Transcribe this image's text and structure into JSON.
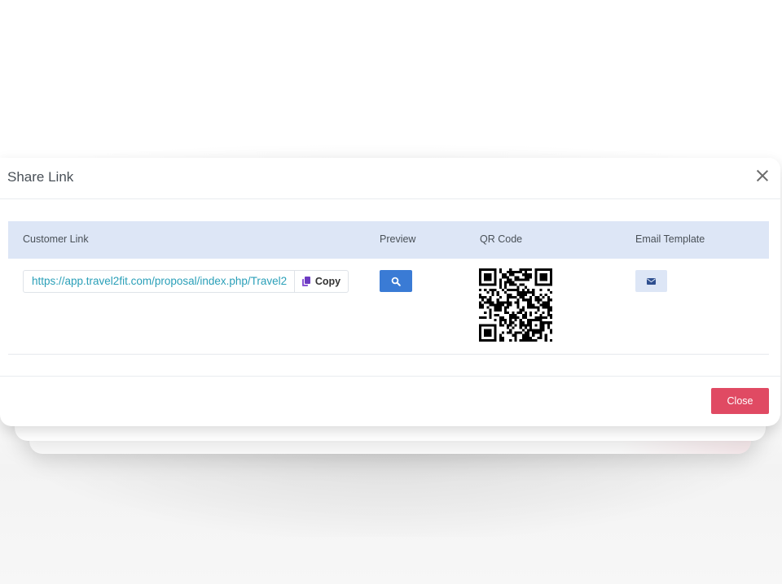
{
  "modal": {
    "title": "Share Link",
    "close_icon": "close-icon"
  },
  "table": {
    "headers": [
      "Customer Link",
      "Preview",
      "QR Code",
      "Email Template"
    ],
    "row": {
      "link_value": "https://app.travel2fit.com/proposal/index.php/Travel2",
      "copy_label": "Copy",
      "copy_icon": "copy-icon",
      "preview_icon": "search-icon",
      "qr_icon": "qr-code",
      "email_icon": "envelope-icon"
    }
  },
  "footer": {
    "close_label": "Close"
  },
  "colors": {
    "accent_blue": "#3a7bd5",
    "header_bg": "#dde6f6",
    "link_text": "#2a9fb8",
    "close_button": "#e04a63",
    "copy_icon": "#7a47cc"
  }
}
